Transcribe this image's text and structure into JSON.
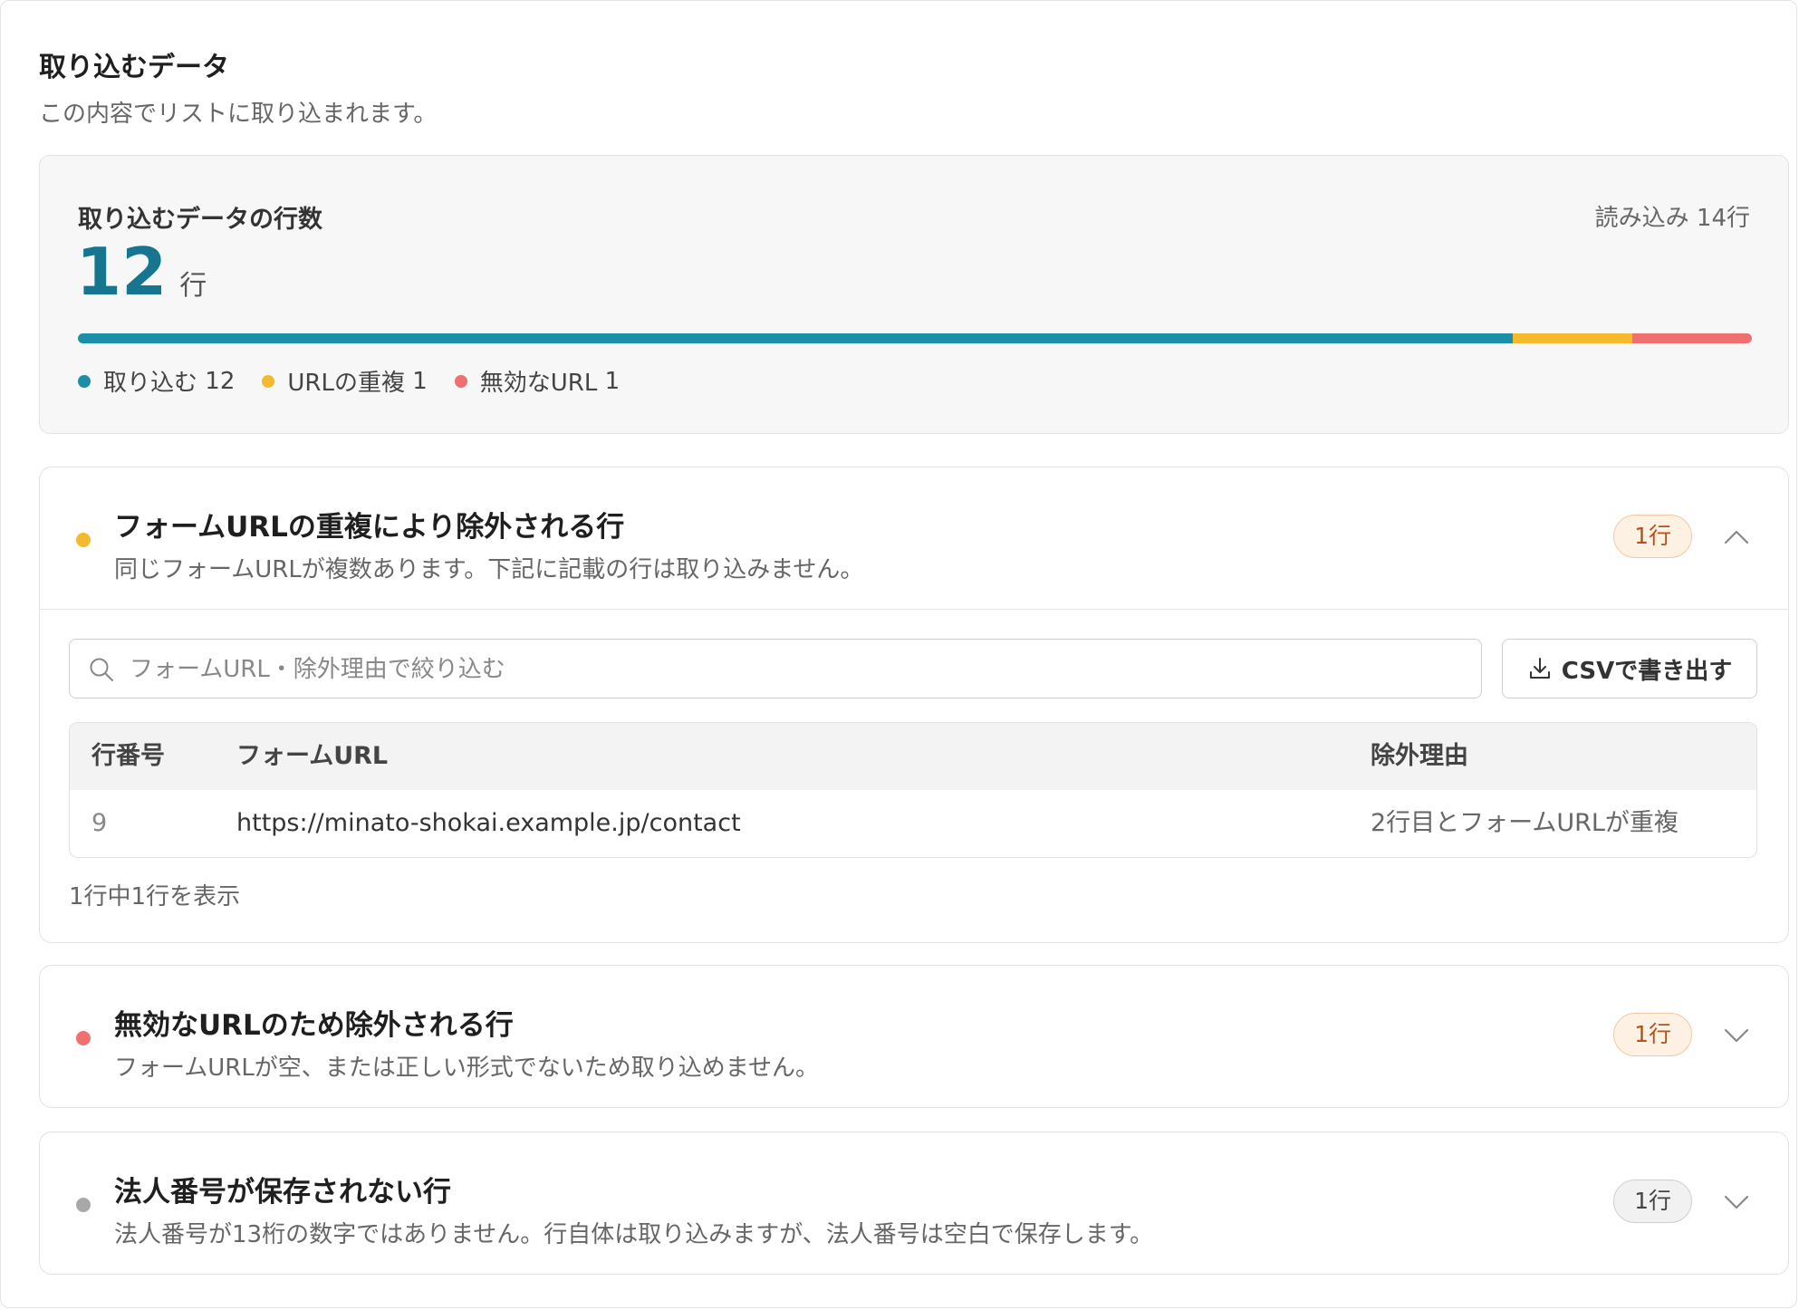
{
  "header": {
    "title": "取り込むデータ",
    "subtitle": "この内容でリストに取り込まれます。"
  },
  "summary": {
    "label": "取り込むデータの行数",
    "read_text": "読み込み 14行",
    "count": "12",
    "count_unit": "行",
    "bar": [
      {
        "key": "import",
        "value": 12,
        "color": "#1b8fa8"
      },
      {
        "key": "dup",
        "value": 1,
        "color": "#f5b92e"
      },
      {
        "key": "invalid",
        "value": 1,
        "color": "#f07070"
      }
    ],
    "legend": [
      {
        "label": "取り込む",
        "count": "12",
        "color": "#1b8fa8"
      },
      {
        "label": "URLの重複",
        "count": "1",
        "color": "#f5b92e"
      },
      {
        "label": "無効なURL",
        "count": "1",
        "color": "#f07070"
      }
    ]
  },
  "sections": {
    "dup": {
      "title": "フォームURLの重複により除外される行",
      "desc": "同じフォームURLが複数あります。下記に記載の行は取り込みません。",
      "badge": "1行",
      "color": "#f5b92e",
      "expanded": true,
      "search_placeholder": "フォームURL・除外理由で絞り込む",
      "csv_label": "CSVで書き出す",
      "table": {
        "headers": [
          "行番号",
          "フォームURL",
          "除外理由"
        ],
        "rows": [
          [
            "9",
            "https://minato-shokai.example.jp/contact",
            "2行目とフォームURLが重複"
          ]
        ]
      },
      "footer": "1行中1行を表示"
    },
    "invalid": {
      "title": "無効なURLのため除外される行",
      "desc": "フォームURLが空、または正しい形式でないため取り込めません。",
      "badge": "1行",
      "color": "#f07070",
      "expanded": false
    },
    "corp": {
      "title": "法人番号が保存されない行",
      "desc": "法人番号が13桁の数字ではありません。行自体は取り込みますが、法人番号は空白で保存します。",
      "badge": "1行",
      "color": "#a8a8a8",
      "expanded": false
    }
  },
  "icons": {
    "search": "search-icon",
    "download": "download-icon",
    "chevron_up": "chevron-up-icon",
    "chevron_down": "chevron-down-icon"
  }
}
